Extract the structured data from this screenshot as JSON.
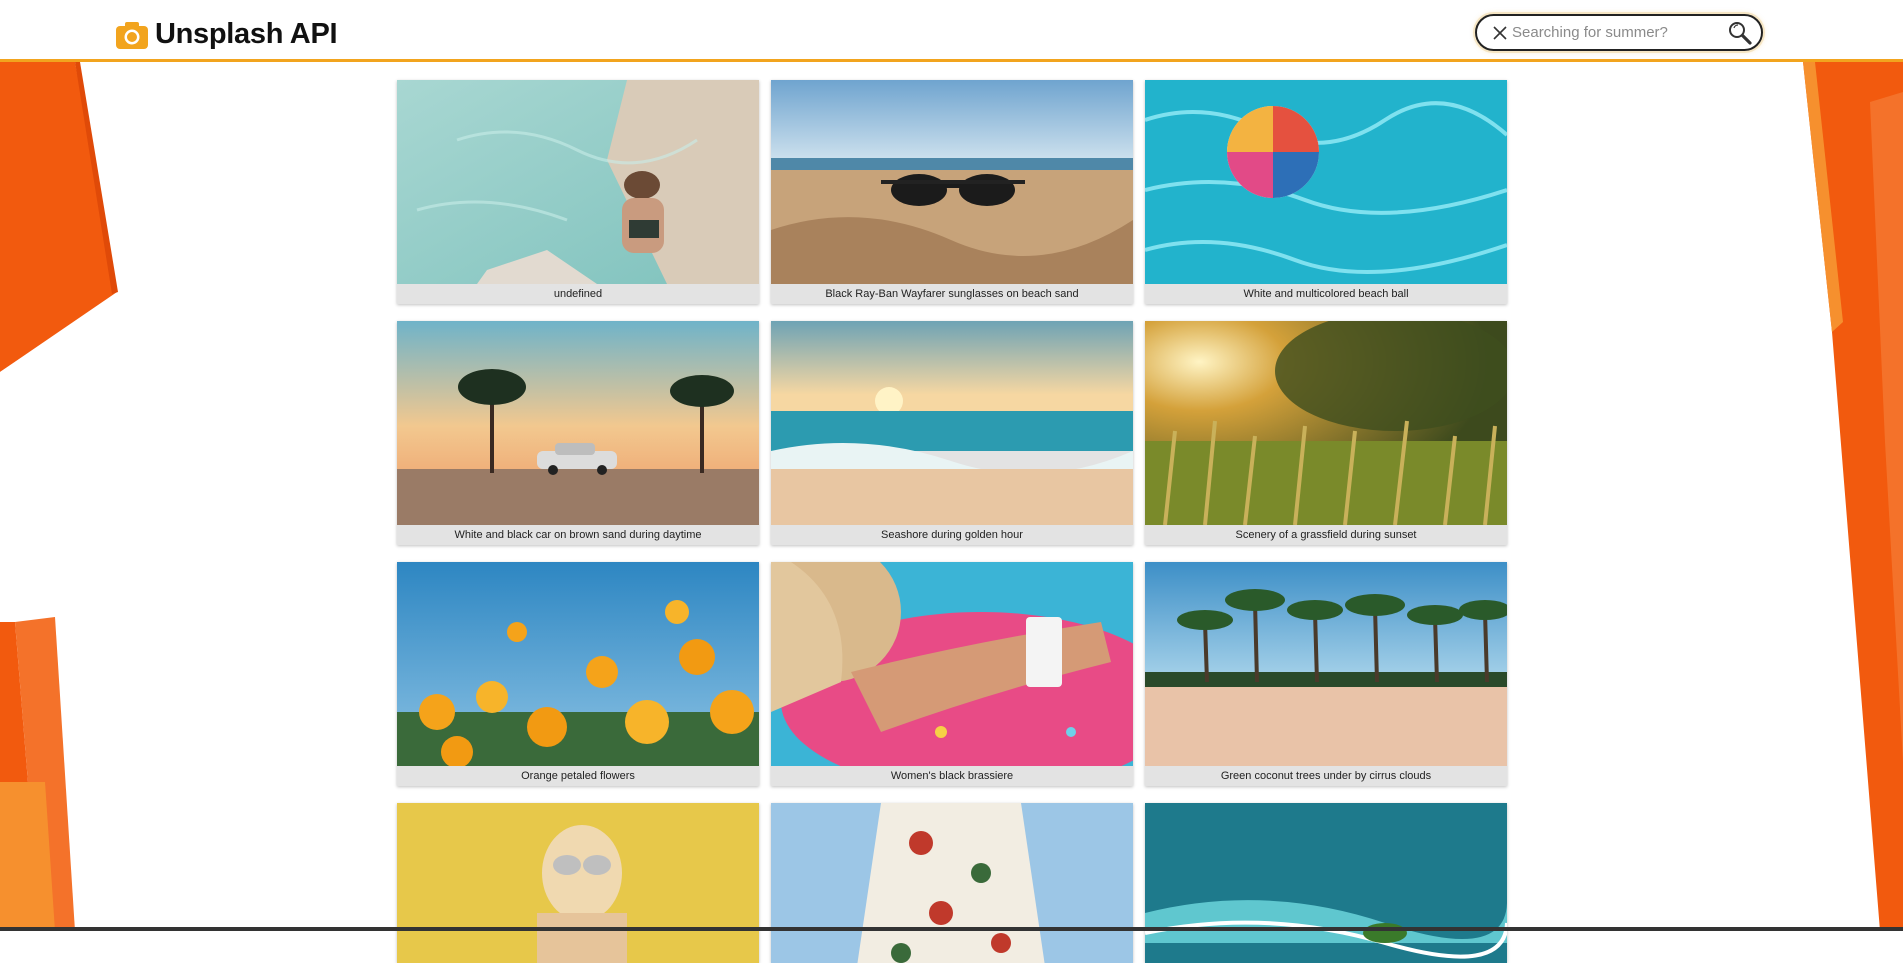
{
  "app": {
    "title": "Unsplash API",
    "brand_icon": "camera-icon",
    "accent_color": "#f2a41e",
    "bg_accent_color": "#f25a0e"
  },
  "search": {
    "placeholder": "Searching for summer?",
    "value": "",
    "clear_icon": "close-icon",
    "submit_icon": "search-icon"
  },
  "gallery": {
    "photos": [
      {
        "caption": "undefined",
        "subject": "woman-in-pool"
      },
      {
        "caption": "Black Ray-Ban Wayfarer sunglasses on beach sand",
        "subject": "sunglasses-on-sand"
      },
      {
        "caption": "White and multicolored beach ball",
        "subject": "beach-ball-in-pool"
      },
      {
        "caption": "White and black car on brown sand during daytime",
        "subject": "car-between-palms"
      },
      {
        "caption": "Seashore during golden hour",
        "subject": "seashore-sunset"
      },
      {
        "caption": "Scenery of a grassfield during sunset",
        "subject": "grassfield-sunset"
      },
      {
        "caption": "Orange petaled flowers",
        "subject": "orange-flowers"
      },
      {
        "caption": "Women's black brassiere",
        "subject": "woman-on-donut-float"
      },
      {
        "caption": "Green coconut trees under by cirrus clouds",
        "subject": "palm-beach"
      },
      {
        "caption": "",
        "subject": "woman-yellow-wall"
      },
      {
        "caption": "",
        "subject": "floral-dress"
      },
      {
        "caption": "",
        "subject": "aerial-beach"
      }
    ]
  }
}
